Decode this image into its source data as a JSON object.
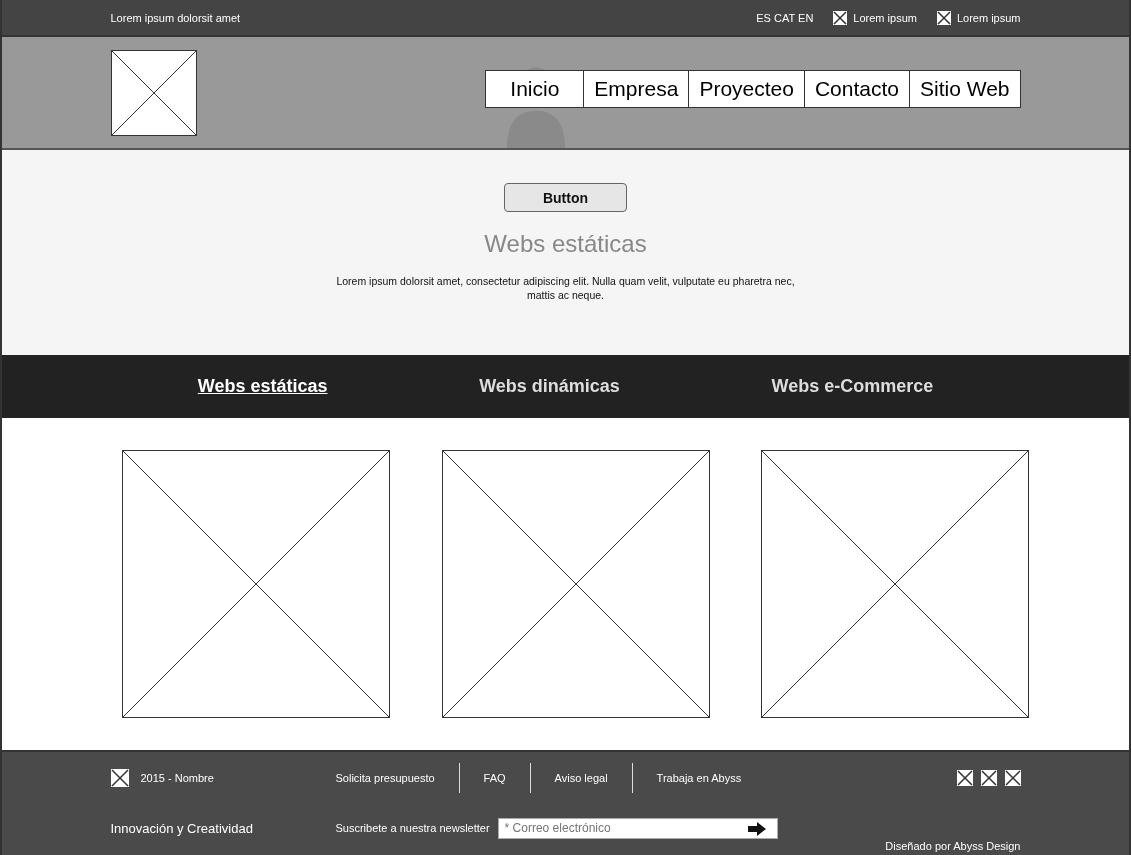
{
  "top_bar": {
    "tagline": "Lorem ipsum dolorsit amet",
    "languages": "ES CAT EN",
    "links": [
      "Lorem ipsum",
      "Lorem ipsum"
    ]
  },
  "nav": [
    {
      "label": "Inicio"
    },
    {
      "label": "Empresa"
    },
    {
      "label": "Proyecteo"
    },
    {
      "label": "Contacto"
    },
    {
      "label": "Sitio Web"
    }
  ],
  "hero": {
    "button": "Button",
    "title": "Webs estáticas",
    "text": "Lorem ipsum dolorsit amet, consectetur adipiscing elit. Nulla quam velit, vulputate eu pharetra nec, mattis ac neque."
  },
  "tabs": [
    {
      "label": "Webs estáticas",
      "selected": true
    },
    {
      "label": "Webs dinámicas",
      "selected": false
    },
    {
      "label": "Webs e-Commerce",
      "selected": false
    }
  ],
  "gallery": [
    {
      "kind": "placeholder"
    },
    {
      "kind": "placeholder"
    },
    {
      "kind": "placeholder"
    }
  ],
  "footer": {
    "copyright": "2015 - Nombre",
    "links": [
      "Solicita presupuesto",
      "FAQ",
      "Aviso legal",
      "Trabaja en Abyss"
    ],
    "slogan": "Innovación y Creatividad",
    "newsletter_label": "Suscribete a nuestra newsletter",
    "email": {
      "placeholder": "* Correo electrónico"
    },
    "credit": "Diseñado por Abyss Design"
  }
}
